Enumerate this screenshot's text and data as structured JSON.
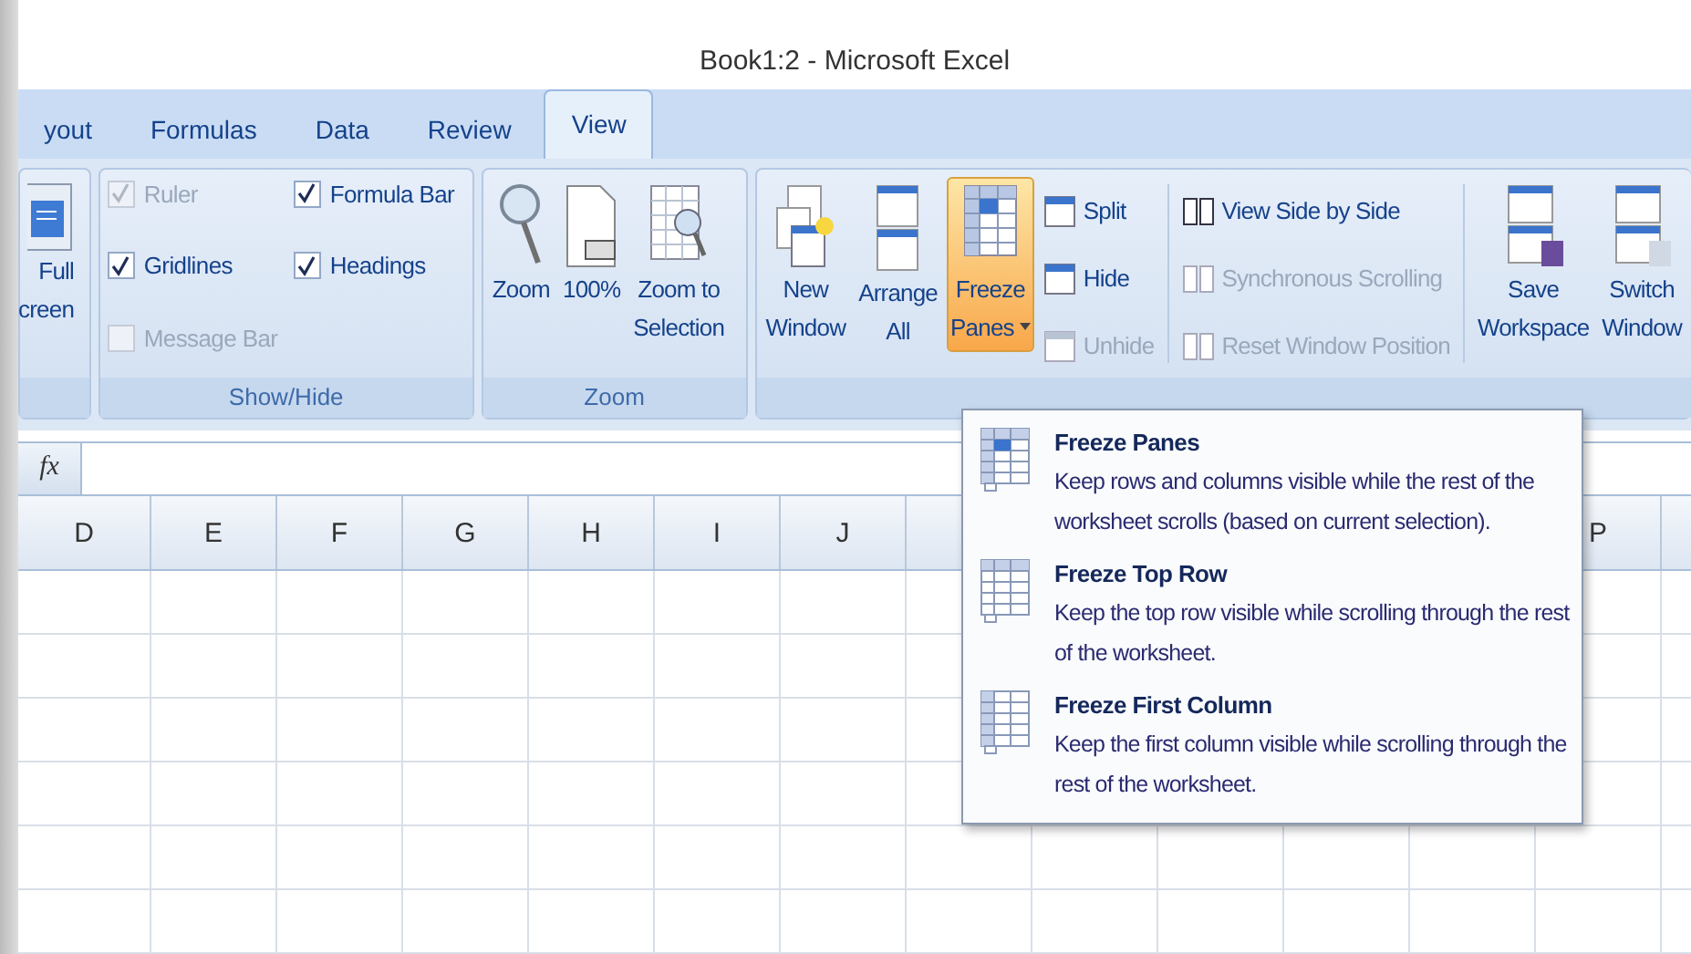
{
  "window": {
    "title": "Book1:2 - Microsoft Excel"
  },
  "tabs": [
    {
      "label": "yout",
      "selected": false
    },
    {
      "label": "Formulas",
      "selected": false
    },
    {
      "label": "Data",
      "selected": false
    },
    {
      "label": "Review",
      "selected": false
    },
    {
      "label": "View",
      "selected": true
    }
  ],
  "ribbon": {
    "groups": [
      {
        "kind": "views",
        "buttons": [
          {
            "lines": [
              "Full",
              "creen"
            ]
          }
        ]
      },
      {
        "kind": "checks",
        "label": "Show/Hide",
        "checks": [
          {
            "label": "Ruler",
            "checked": true,
            "disabled": true
          },
          {
            "label": "Formula Bar",
            "checked": true,
            "disabled": false
          },
          {
            "label": "Gridlines",
            "checked": true,
            "disabled": false
          },
          {
            "label": "Headings",
            "checked": true,
            "disabled": false
          },
          {
            "label": "Message Bar",
            "checked": false,
            "disabled": true
          }
        ]
      },
      {
        "kind": "zoom",
        "label": "Zoom",
        "buttons": [
          {
            "lines": [
              "Zoom"
            ]
          },
          {
            "lines": [
              "100%"
            ]
          },
          {
            "lines": [
              "Zoom to",
              "Selection"
            ]
          }
        ]
      },
      {
        "kind": "window",
        "buttons": [
          {
            "lines": [
              "New",
              "Window"
            ],
            "selected": false
          },
          {
            "lines": [
              "Arrange",
              "All"
            ],
            "selected": false
          },
          {
            "lines": [
              "Freeze",
              "Panes"
            ],
            "selected": true
          }
        ],
        "small": [
          {
            "label": "Split",
            "disabled": false
          },
          {
            "label": "Hide",
            "disabled": false
          },
          {
            "label": "Unhide",
            "disabled": true
          }
        ],
        "small2": [
          {
            "label": "View Side by Side",
            "disabled": false
          },
          {
            "label": "Synchronous Scrolling",
            "disabled": true
          },
          {
            "label": "Reset Window Position",
            "disabled": true
          }
        ],
        "buttons2": [
          {
            "lines": [
              "Save",
              "Workspace"
            ]
          },
          {
            "lines": [
              "Switch",
              "Window"
            ]
          }
        ]
      }
    ]
  },
  "formula_bar": {
    "fx": "fx"
  },
  "sheet": {
    "columns_left": [
      "D",
      "E",
      "F",
      "G",
      "H",
      "I",
      "J"
    ],
    "columns_right": [
      "P"
    ]
  },
  "menu": {
    "items": [
      {
        "title": "Freeze Panes",
        "desc": "Keep rows and columns visible while the rest of the worksheet scrolls (based on current selection)."
      },
      {
        "title": "Freeze Top Row",
        "desc": "Keep the top row visible while scrolling through the rest of the worksheet."
      },
      {
        "title": "Freeze First Column",
        "desc": "Keep the first column visible while scrolling through the rest of the worksheet."
      }
    ]
  }
}
